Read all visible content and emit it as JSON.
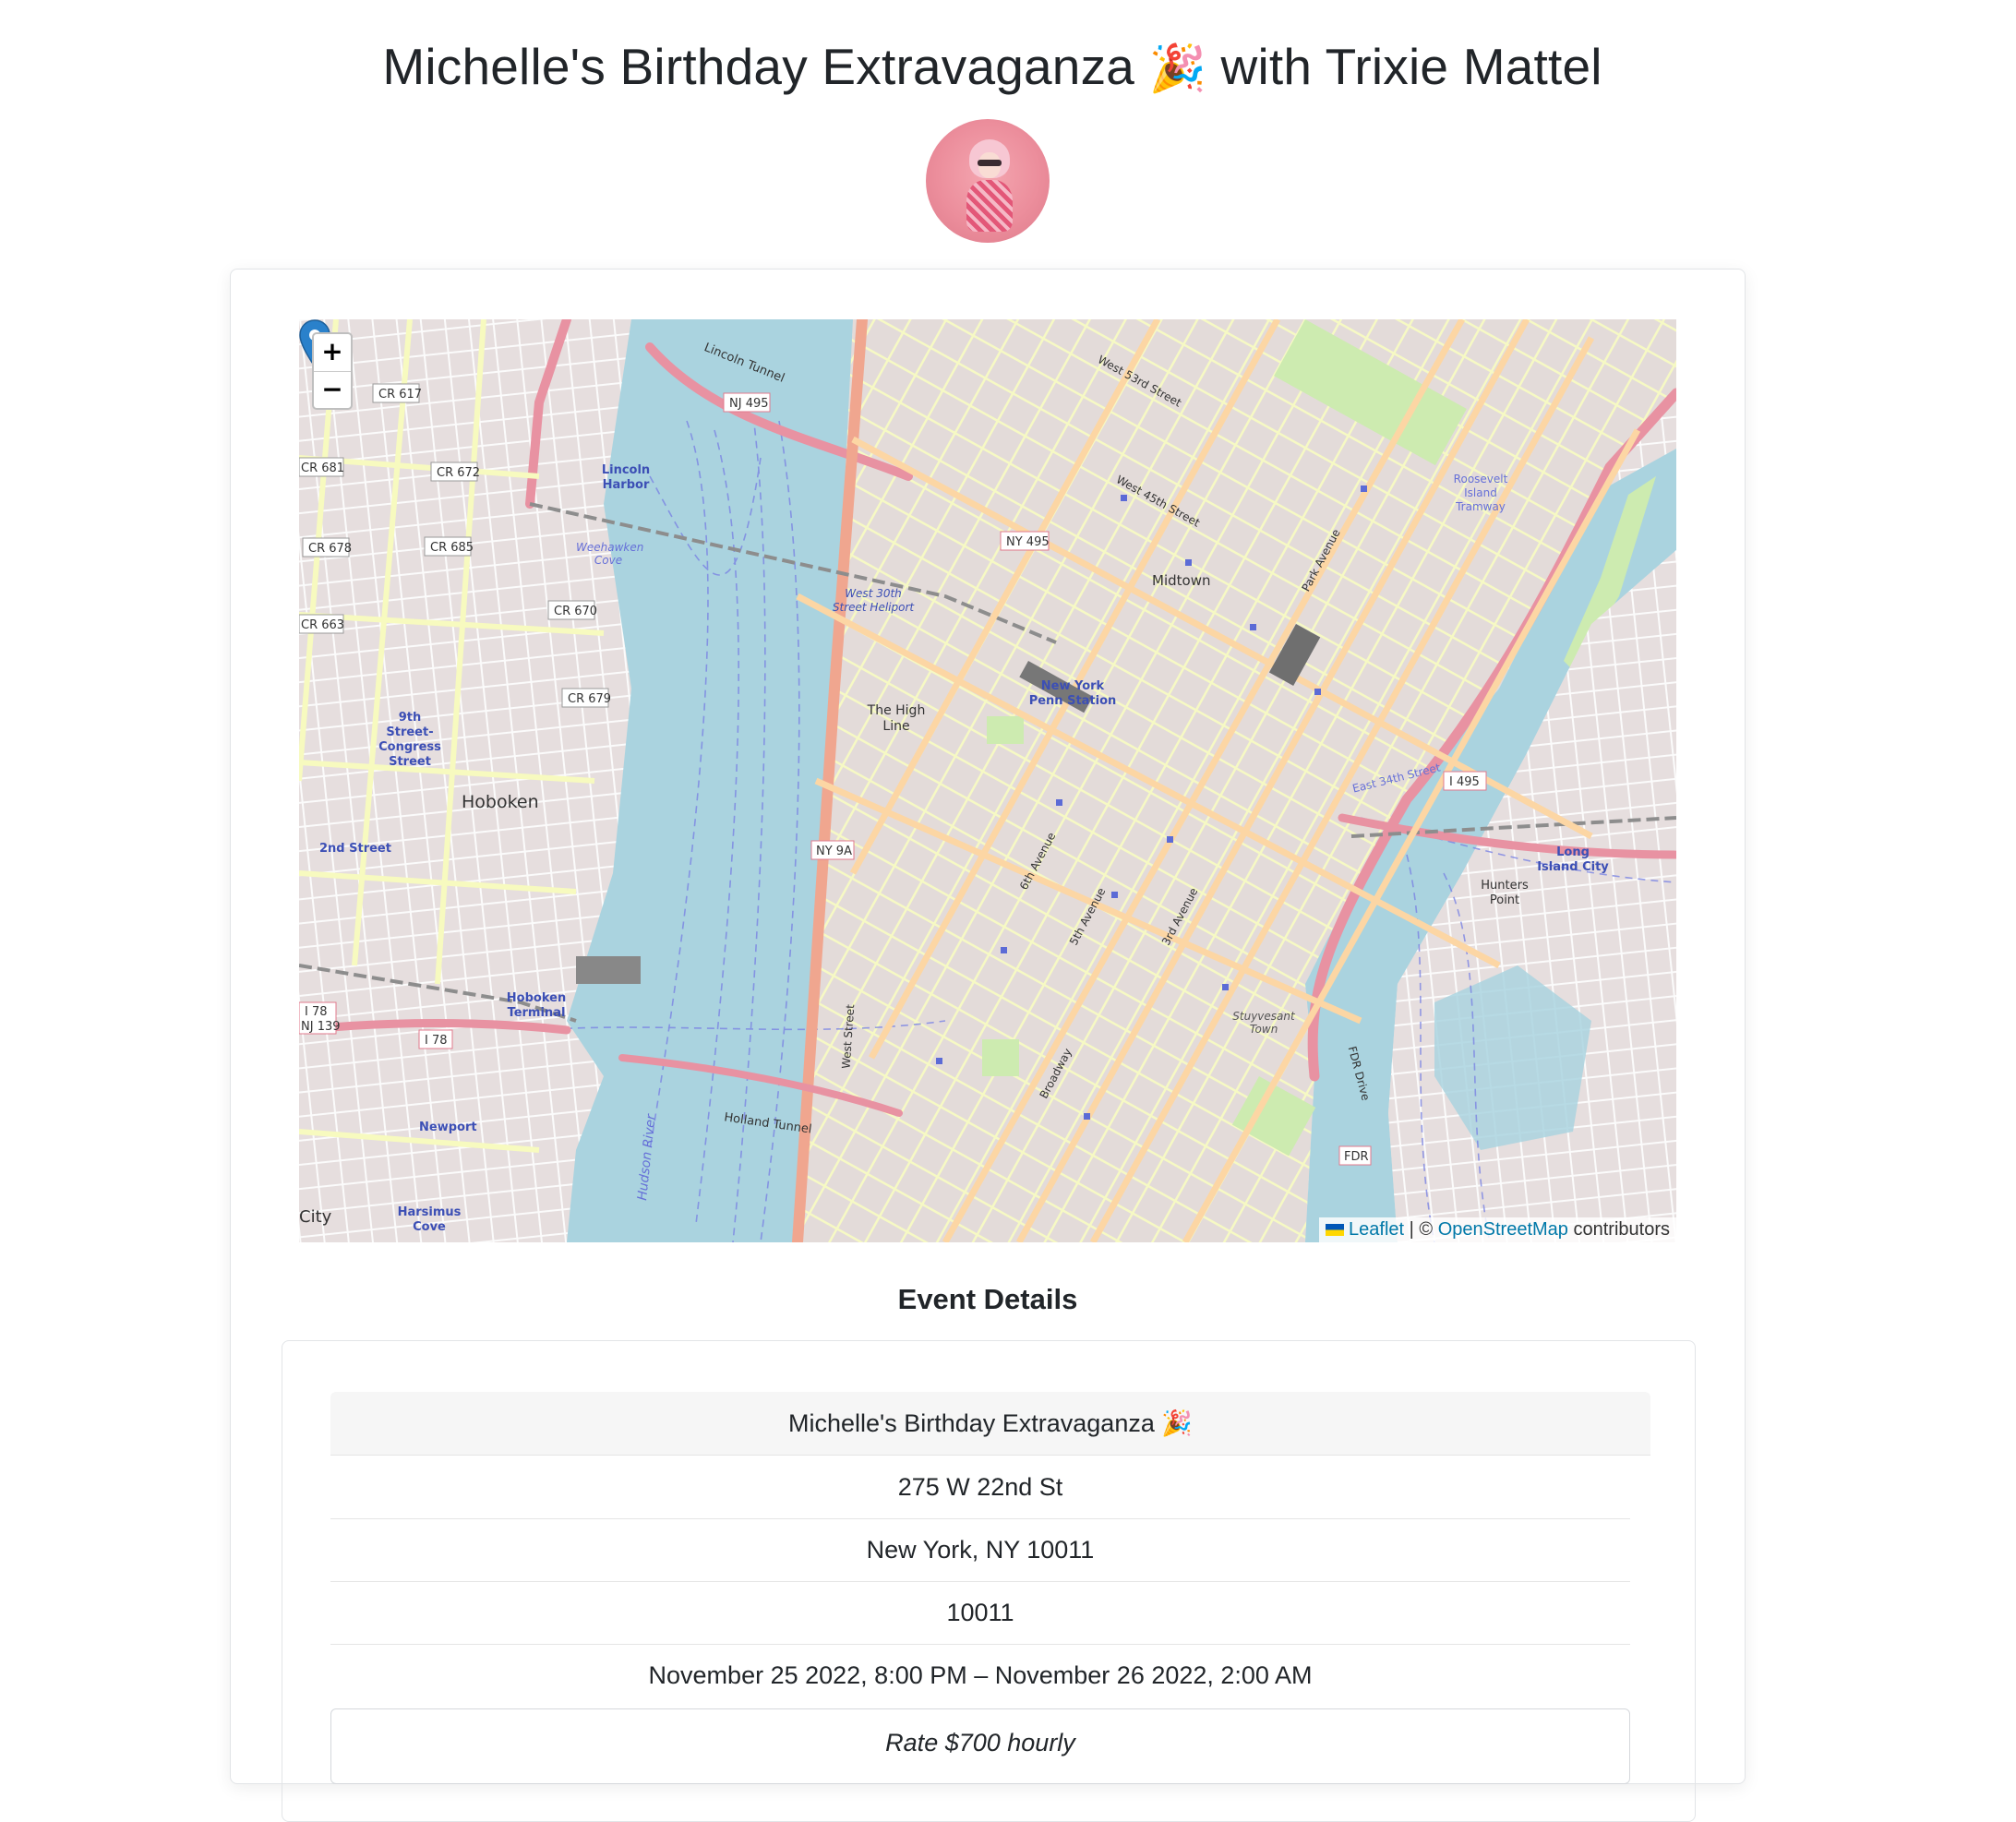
{
  "header": {
    "title_before": "Michelle's Birthday Extravaganza ",
    "emoji": "🎉",
    "title_after": " with Trixie Mattel"
  },
  "map": {
    "zoom_in": "+",
    "zoom_out": "−",
    "attribution": {
      "leaflet": "Leaflet",
      "separator": "| ©",
      "osm": "OpenStreetMap",
      "suffix": "contributors"
    },
    "labels": {
      "hoboken": "Hoboken",
      "midtown": "Midtown",
      "high_line": "The High Line",
      "penn": "New York Penn Station",
      "lincoln_harbor": "Lincoln Harbor",
      "hoboken_terminal": "Hoboken Terminal",
      "newport": "Newport",
      "harsimus": "Harsimus Cove",
      "long_island_city": "Long Island City",
      "hunters_point": "Hunters Point",
      "west_30th_heliport": "West 30th Street Heliport",
      "ninth_street": "9th Street-Congress Street",
      "second_street": "2nd Street",
      "roosevelt": "Roosevelt Island Tramway",
      "city": "City",
      "lincoln_tunnel": "Lincoln Tunnel",
      "holland_tunnel": "Holland Tunnel",
      "west_street": "West Street",
      "broadway": "Broadway",
      "fdr_drive": "FDR Drive",
      "fifth_ave": "5th Avenue",
      "sixth_ave": "6th Avenue",
      "third_ave": "3rd Avenue",
      "hudson_river": "Hudson River",
      "stuyvesant": "Stuyvesant Town",
      "weehawken": "Weehawken Cove",
      "w45": "West 45th Street",
      "w53": "West 53rd Street",
      "park_ave": "Park Avenue",
      "e34": "East 34th Street"
    },
    "shields": [
      "NJ 495",
      "NY 495",
      "NY 9A",
      "I 78",
      "NJ 139",
      "I 495",
      "CR 617",
      "CR 681",
      "CR 672",
      "CR 678",
      "CR 685",
      "CR 670",
      "CR 663",
      "CR 679",
      "FDR"
    ]
  },
  "details": {
    "heading": "Event Details",
    "event_name_text": "Michelle's Birthday Extravaganza ",
    "event_emoji": "🎉",
    "address": "275 W 22nd St",
    "city_line": "New York, NY 10011",
    "zip": "10011",
    "datetime": "November 25 2022, 8:00 PM – November 26 2022, 2:00 AM",
    "rate": "Rate $700 hourly"
  },
  "colors": {
    "water": "#aad3df",
    "land": "#f2efe9",
    "major_road": "#e892a2",
    "secondary_road": "#fcd6a4",
    "street": "#f7fabf",
    "marker": "#2a81cb"
  }
}
